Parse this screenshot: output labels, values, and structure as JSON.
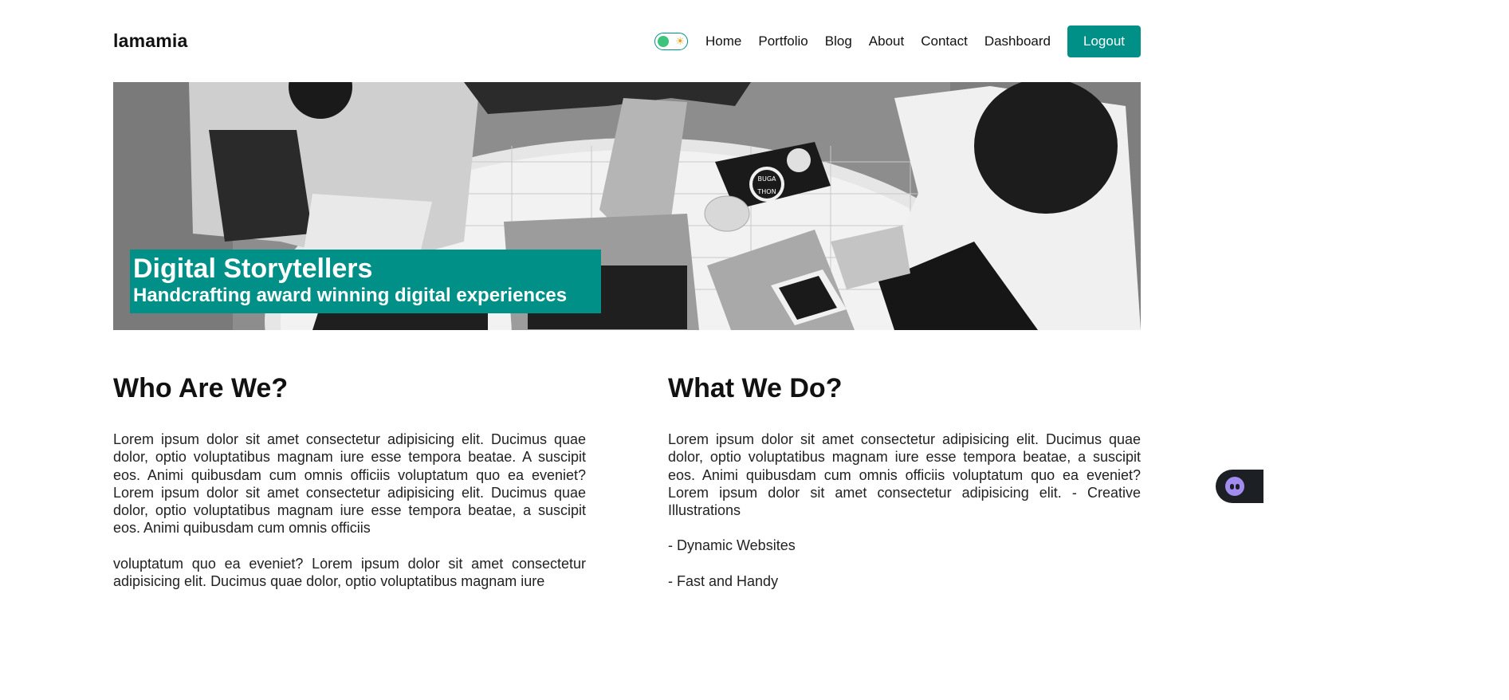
{
  "header": {
    "logo": "lamamia",
    "theme_toggle": {
      "state": "light",
      "icon": "sun-icon"
    },
    "nav": [
      "Home",
      "Portfolio",
      "Blog",
      "About",
      "Contact",
      "Dashboard"
    ],
    "logout_label": "Logout"
  },
  "hero": {
    "title": "Digital Storytellers",
    "subtitle": "Handcrafting award winning digital experiences",
    "caption_color": "#009087",
    "sticker_text": [
      "BUGA",
      "THON"
    ]
  },
  "who": {
    "heading": "Who Are We?",
    "para1": "Lorem ipsum dolor sit amet consectetur adipisicing elit. Ducimus quae dolor, optio voluptatibus magnam iure esse tempora beatae. A suscipit eos. Animi quibusdam cum omnis officiis voluptatum quo ea eveniet? Lorem ipsum dolor sit amet consectetur adipisicing elit. Ducimus quae dolor, optio voluptatibus magnam iure esse tempora beatae, a suscipit eos. Animi quibusdam cum omnis officiis",
    "para2": "voluptatum quo ea eveniet? Lorem ipsum dolor sit amet consectetur adipisicing elit. Ducimus quae dolor, optio voluptatibus magnam iure"
  },
  "what": {
    "heading": "What We Do?",
    "para1": "Lorem ipsum dolor sit amet consectetur adipisicing elit. Ducimus quae dolor, optio voluptatibus magnam iure esse tempora beatae, a suscipit eos. Animi quibusdam cum omnis officiis voluptatum quo ea eveniet? Lorem ipsum dolor sit amet consectetur adipisicing elit. - Creative Illustrations",
    "items": [
      "- Dynamic Websites",
      "- Fast and Handy"
    ]
  },
  "colors": {
    "accent": "#009087",
    "toggle_knob": "#3cc47c",
    "sun": "#e6a116",
    "widget_bg": "#1c1f24"
  }
}
